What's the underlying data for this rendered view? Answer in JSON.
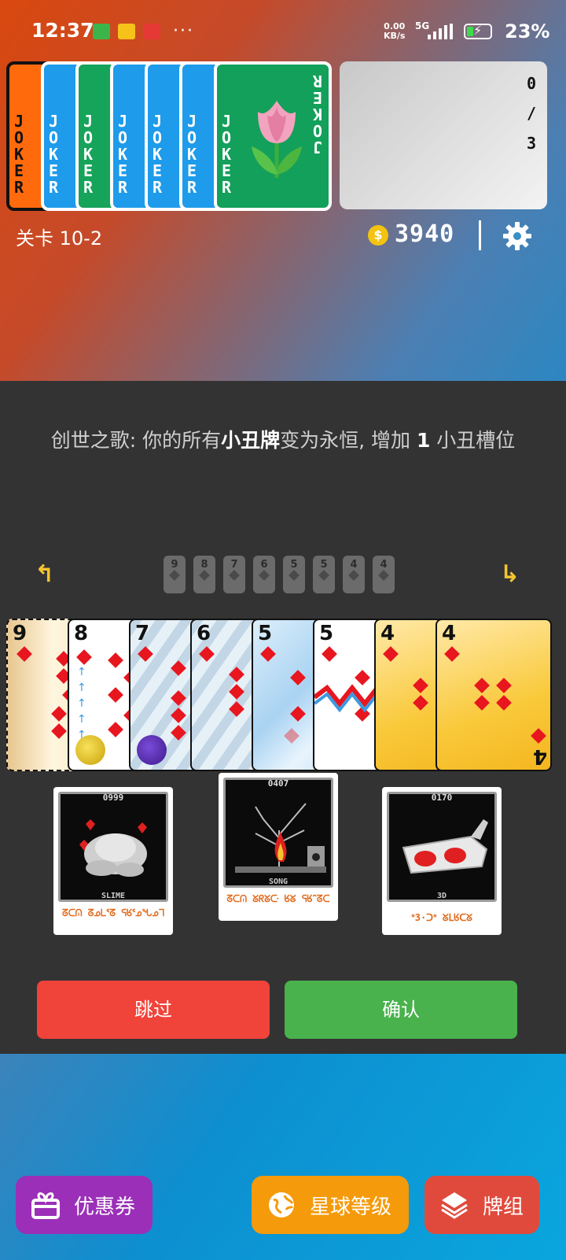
{
  "status": {
    "time": "12:37",
    "net_speed_top": "0.00",
    "net_speed_bottom": "KB/s",
    "network": "5G",
    "battery": "23%",
    "dots": "···"
  },
  "jokers": {
    "label": "JOKER",
    "slots_top": "0",
    "slots_sep": "/",
    "slots_bottom": "3"
  },
  "level": "关卡 10-2",
  "coins": "3940",
  "description": {
    "prefix": "创世之歌: 你的所有",
    "bold1": "小丑牌",
    "middle": "变为永恒, 增加 ",
    "bold2": "1",
    "suffix": " 小丑槽位"
  },
  "navigation": {
    "left_arrow": "↰",
    "right_arrow": "↳"
  },
  "mini_cards": [
    "9",
    "8",
    "7",
    "6",
    "5",
    "5",
    "4",
    "4"
  ],
  "hand": [
    {
      "rank": "9",
      "suit": "diamond",
      "style": "burnt"
    },
    {
      "rank": "8",
      "suit": "diamond",
      "style": "arrows"
    },
    {
      "rank": "7",
      "suit": "diamond",
      "style": "glass"
    },
    {
      "rank": "6",
      "suit": "diamond",
      "style": "glass"
    },
    {
      "rank": "5",
      "suit": "diamond",
      "style": "holo"
    },
    {
      "rank": "5",
      "suit": "diamond",
      "style": "zigzag"
    },
    {
      "rank": "4",
      "suit": "diamond",
      "style": "gold"
    },
    {
      "rank": "4",
      "suit": "diamond",
      "style": "gold"
    }
  ],
  "choices": [
    {
      "code": "0999",
      "name": "SLIME",
      "rune": "ᘔᑕᕬ ᘔᓄᒪᕐᘔ ᕋᖉᕐᓄᖓᓄᒣ"
    },
    {
      "code": "0407",
      "name": "SONG",
      "rune": "ᘔᑕᕬ ᘜᖇᘜᑢ ᖉᘜ ᕋᖉᐢᘔᑕ"
    },
    {
      "code": "0170",
      "name": "3D",
      "rune": "ᐤ3·ᑐᐤ ᘜᒪᖉᑕᘜ"
    }
  ],
  "buttons": {
    "skip": "跳过",
    "confirm": "确认"
  },
  "bottom_nav": {
    "coupon": "优惠券",
    "planet": "星球等级",
    "deck": "牌组"
  },
  "colors": {
    "skip": "#f0433a",
    "confirm": "#49b24d",
    "diamond": "#e8161f",
    "accent_arrow": "#f4c430"
  }
}
